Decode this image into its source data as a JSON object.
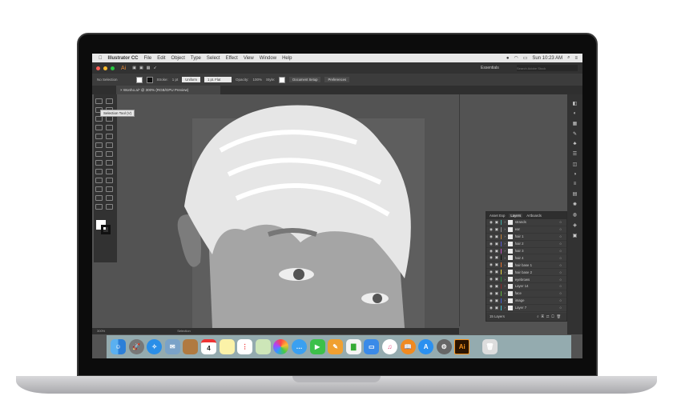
{
  "menubar": {
    "app": "Illustrator CC",
    "items": [
      "File",
      "Edit",
      "Object",
      "Type",
      "Select",
      "Effect",
      "View",
      "Window",
      "Help"
    ],
    "clock": "Sun 10:23 AM"
  },
  "appbar": {
    "logo": "Ai",
    "workspace": "Essentials",
    "search_placeholder": "Search Adobe Stock"
  },
  "control": {
    "selection": "No Selection",
    "stroke_label": "Stroke:",
    "stroke_value": "1 pt",
    "profile": "Uniform",
    "brush": "1 pt. Flat",
    "opacity_label": "Opacity:",
    "opacity_value": "100%",
    "style_label": "Style:",
    "doc_setup": "Document Setup",
    "preferences": "Preferences"
  },
  "document": {
    "tab": "Wonho.ai* @ 300% (RGB/GPU Preview)",
    "zoom": "300%",
    "status": "Selection"
  },
  "tooltip": "Selection Tool (V)",
  "layers_panel": {
    "tabs": [
      "Asset Exp",
      "Layers",
      "Artboards"
    ],
    "active_tab": "Layers",
    "footer": "15 Layers",
    "layers": [
      {
        "name": "strands",
        "color": "#3fa9a0"
      },
      {
        "name": "ear",
        "color": "#8a8a8a"
      },
      {
        "name": "hair 1",
        "color": "#c0803a"
      },
      {
        "name": "hair 2",
        "color": "#5a5ad0"
      },
      {
        "name": "hair 3",
        "color": "#c050c0"
      },
      {
        "name": "hair 4",
        "color": "#111111"
      },
      {
        "name": "hair base 1",
        "color": "#e07030"
      },
      {
        "name": "hair base 2",
        "color": "#e0d040"
      },
      {
        "name": "eyebrows",
        "color": "#2a8a3a"
      },
      {
        "name": "Layer 14",
        "color": "#8a2a2a"
      },
      {
        "name": "face",
        "color": "#60b040"
      },
      {
        "name": "image",
        "color": "#4060d0"
      },
      {
        "name": "Layer 7",
        "color": "#40c0d0"
      }
    ]
  },
  "dock": {
    "calendar_day": "4",
    "illustrator": "Ai",
    "apps": [
      "finder",
      "launchpad",
      "safari",
      "mail",
      "contacts",
      "calendar",
      "notes",
      "reminders",
      "maps",
      "photos",
      "messages",
      "facetime",
      "pages",
      "numbers",
      "keynote",
      "itunes",
      "ibooks",
      "app-store",
      "system-preferences",
      "illustrator",
      "trash"
    ]
  }
}
